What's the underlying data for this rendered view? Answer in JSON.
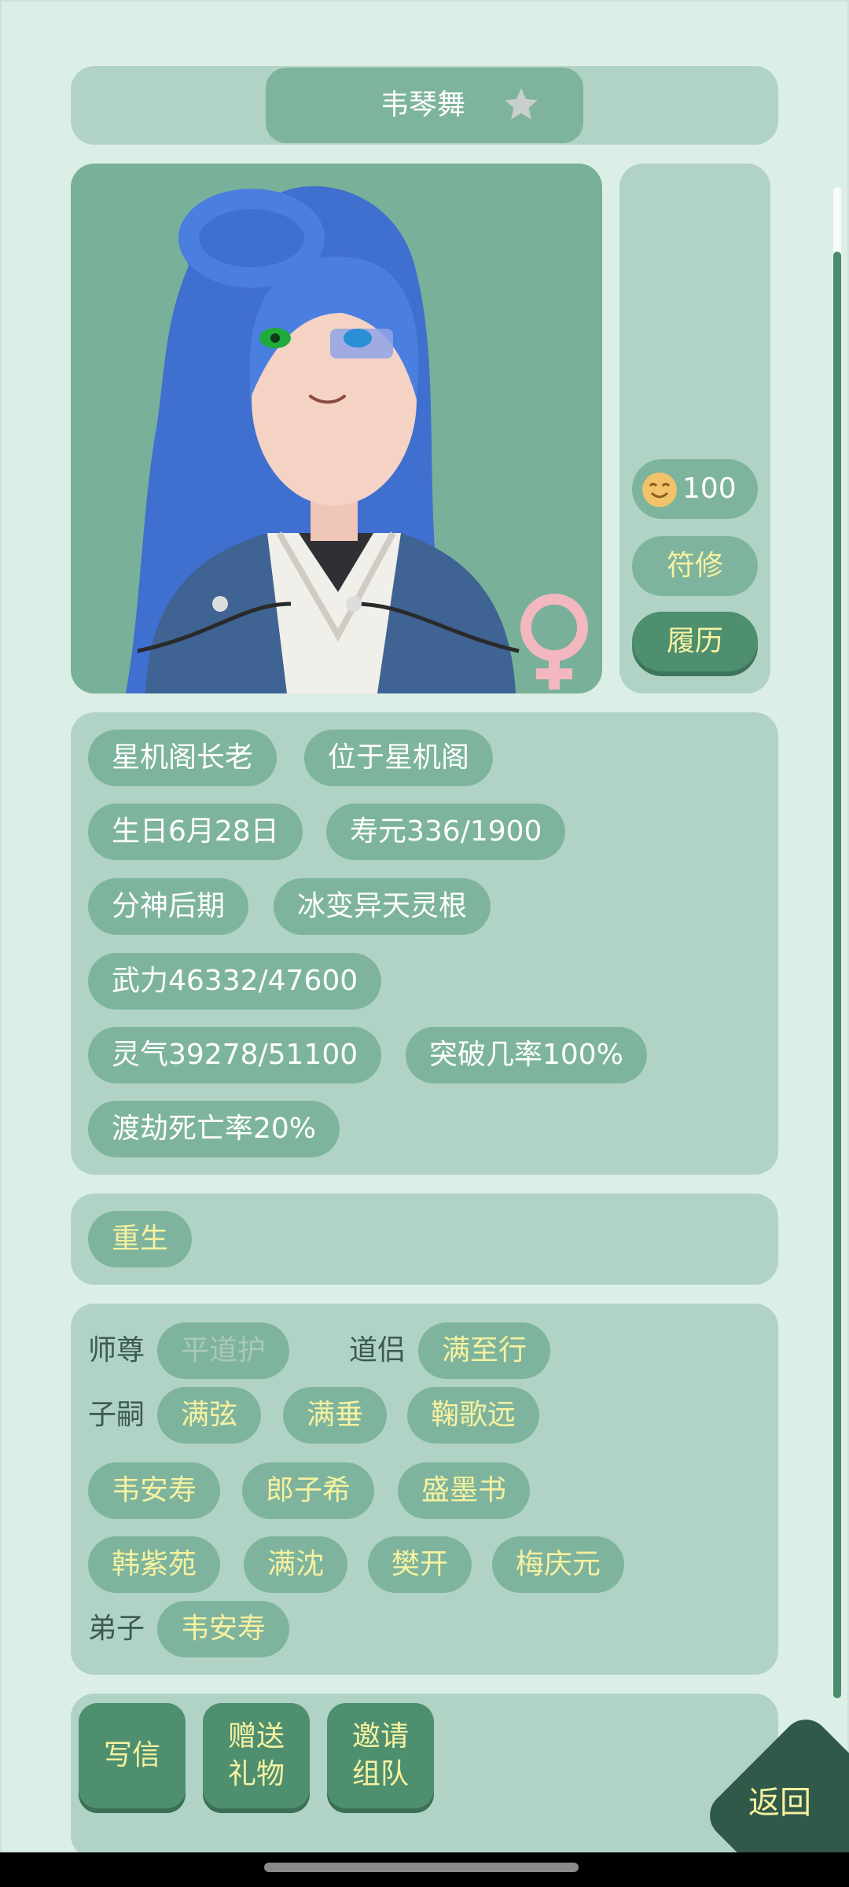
{
  "header": {
    "name": "韦琴舞",
    "favorite_icon": "star-icon"
  },
  "portrait": {
    "gender_icon": "female-symbol-icon",
    "character": "blue-haired-female-cultivator"
  },
  "side": {
    "mood_value": "100",
    "mood_icon": "smile-face-icon",
    "class_label": "符修",
    "record_label": "履历"
  },
  "stats": {
    "title": "星机阁长老",
    "location": "位于星机阁",
    "birthday": "生日6月28日",
    "lifespan": "寿元336/1900",
    "realm": "分神后期",
    "root": "冰变异天灵根",
    "power": "武力46332/47600",
    "qi": "灵气39278/51100",
    "breakthrough": "突破几率100%",
    "tribulation_death": "渡劫死亡率20%"
  },
  "traits": [
    "重生"
  ],
  "relations": {
    "master_label": "师尊",
    "master": "平道护",
    "partner_label": "道侣",
    "partner": "满至行",
    "children_label": "子嗣",
    "children": [
      "满弦",
      "满垂",
      "鞠歌远",
      "韦安寿",
      "郎子希",
      "盛墨书",
      "韩紫苑",
      "满沈",
      "樊开",
      "梅庆元"
    ],
    "disciple_label": "弟子",
    "disciples": [
      "韦安寿"
    ]
  },
  "actions": {
    "write_letter": "写信",
    "gift_line1": "赠送",
    "gift_line2": "礼物",
    "invite_line1": "邀请",
    "invite_line2": "组队",
    "return": "返回"
  },
  "colors": {
    "background": "#dcefe7",
    "panel": "#b0d3c6",
    "chip": "#7eb49d",
    "accent_dark": "#4d8f6f",
    "highlight_text": "#f6f1a0"
  }
}
